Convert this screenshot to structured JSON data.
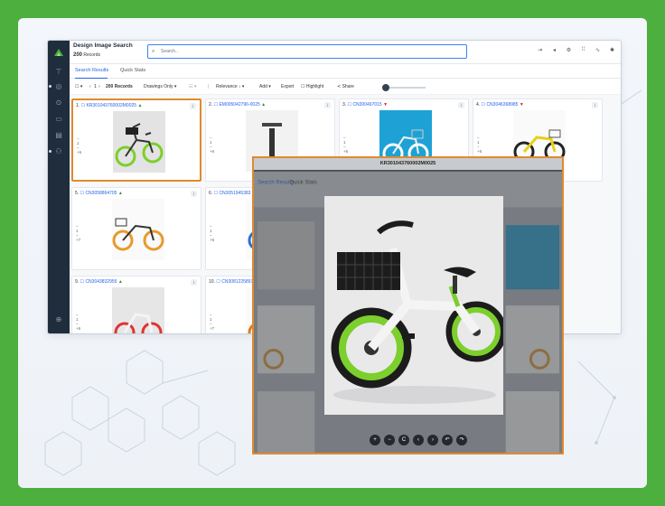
{
  "app": {
    "title": "Design Image Search",
    "record_count": "200",
    "record_label": "Records",
    "search_placeholder": "Search..."
  },
  "tabs": [
    "Search Results",
    "Quick Stats"
  ],
  "toolbar": {
    "page_info": "1",
    "count_label": "200 Records",
    "filter": "Drawings Only",
    "sort": "Relevance",
    "add": "Add",
    "export": "Export",
    "highlight": "Highlight",
    "share": "Share"
  },
  "cards": [
    {
      "num": "1.",
      "id": "KR301043760002M0025",
      "trend": "up"
    },
    {
      "num": "2.",
      "id": "EM00504279​6-0025",
      "trend": "up"
    },
    {
      "num": "3.",
      "id": "CN30049701​5",
      "trend": "down"
    },
    {
      "num": "4.",
      "id": "CN3046368985",
      "trend": "down"
    },
    {
      "num": "5.",
      "id": "CN3058864705",
      "trend": "up"
    },
    {
      "num": "6.",
      "id": "CN3051945383",
      "trend": ""
    },
    {
      "num": "9.",
      "id": "CN3043832955",
      "trend": "up"
    },
    {
      "num": "10.",
      "id": "CN3081225893",
      "trend": ""
    }
  ],
  "lightbox": {
    "title": "KR301043760002M0025",
    "bg_tabs": [
      "Search Results",
      "Quick Stats"
    ],
    "bg_count": "200 Records",
    "bg_share": "Share"
  },
  "colors": {
    "frame": "#4caf3e",
    "accent": "#2563eb",
    "selected_border": "#e08a2e",
    "up": "#2e8b3a",
    "down": "#cc2a2a"
  }
}
